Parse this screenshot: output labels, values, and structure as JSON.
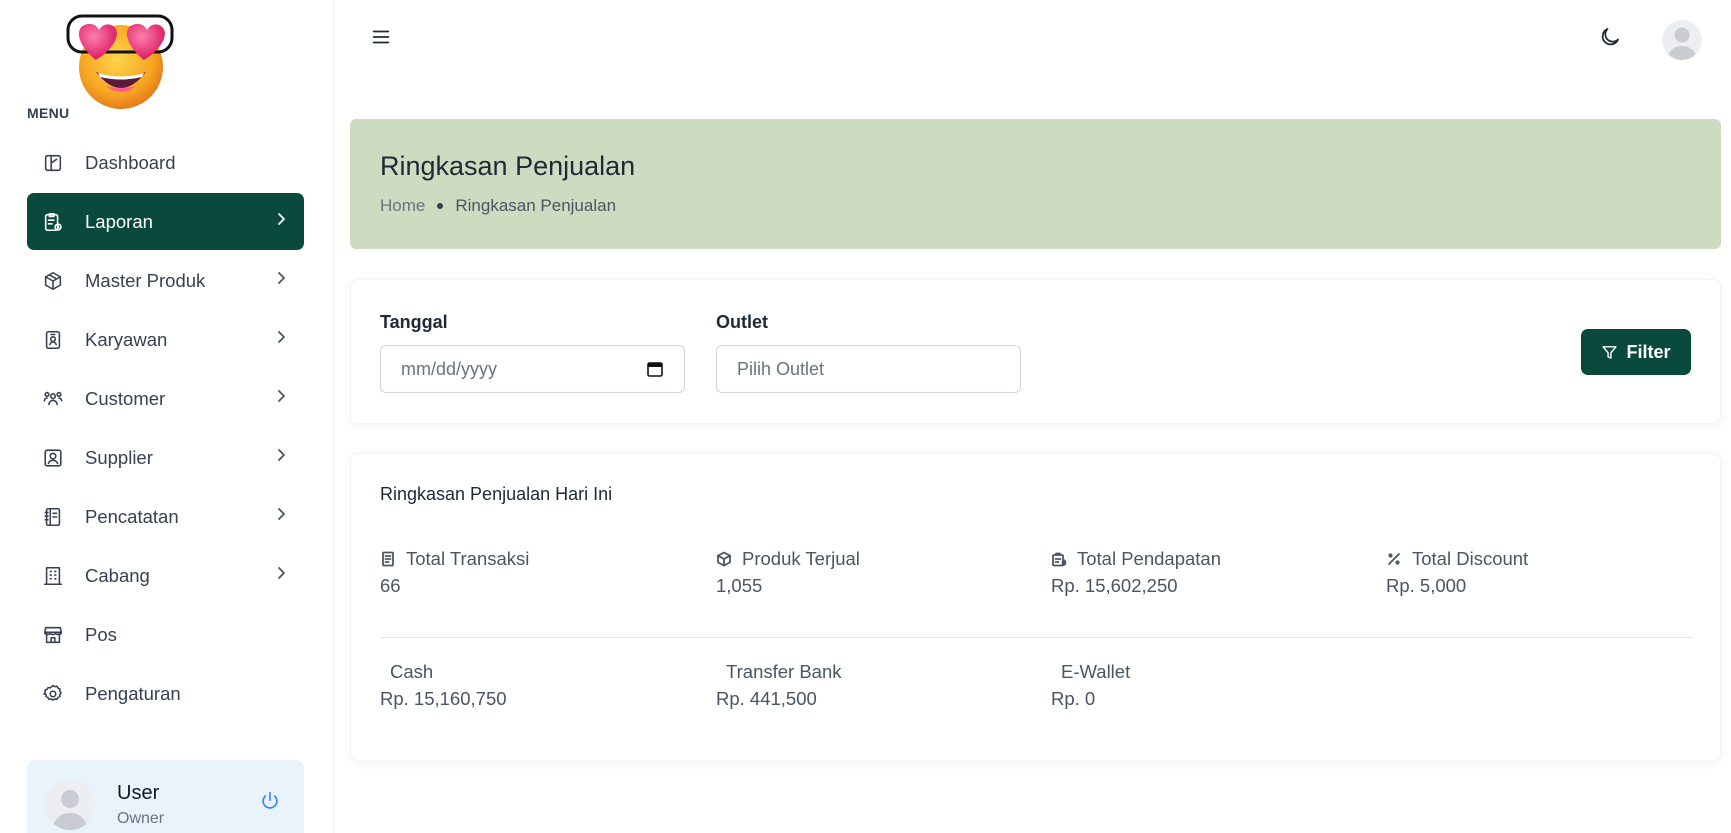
{
  "sidebar": {
    "menu_caption": "MENU",
    "items": [
      {
        "label": "Dashboard",
        "icon": "dashboard-icon",
        "has_chevron": false,
        "active": false
      },
      {
        "label": "Laporan",
        "icon": "report-icon",
        "has_chevron": true,
        "active": true
      },
      {
        "label": "Master Produk",
        "icon": "box-icon",
        "has_chevron": true,
        "active": false
      },
      {
        "label": "Karyawan",
        "icon": "badge-icon",
        "has_chevron": true,
        "active": false
      },
      {
        "label": "Customer",
        "icon": "users-icon",
        "has_chevron": true,
        "active": false
      },
      {
        "label": "Supplier",
        "icon": "contact-icon",
        "has_chevron": true,
        "active": false
      },
      {
        "label": "Pencatatan",
        "icon": "notebook-icon",
        "has_chevron": true,
        "active": false
      },
      {
        "label": "Cabang",
        "icon": "building-icon",
        "has_chevron": true,
        "active": false
      },
      {
        "label": "Pos",
        "icon": "store-icon",
        "has_chevron": false,
        "active": false
      },
      {
        "label": "Pengaturan",
        "icon": "gear-icon",
        "has_chevron": false,
        "active": false
      }
    ],
    "user": {
      "name": "User",
      "role": "Owner"
    }
  },
  "page": {
    "title": "Ringkasan Penjualan",
    "breadcrumb": {
      "home": "Home",
      "current": "Ringkasan Penjualan"
    }
  },
  "filter": {
    "date_label": "Tanggal",
    "date_placeholder": "mm/dd/yyyy",
    "outlet_label": "Outlet",
    "outlet_placeholder": "Pilih Outlet",
    "button_label": "Filter"
  },
  "summary": {
    "title": "Ringkasan Penjualan Hari Ini",
    "stats": [
      {
        "label": "Total Transaksi",
        "value": "66",
        "icon": "receipt-icon"
      },
      {
        "label": "Produk Terjual",
        "value": "1,055",
        "icon": "box-icon"
      },
      {
        "label": "Total Pendapatan",
        "value": "Rp. 15,602,250",
        "icon": "revenue-icon"
      },
      {
        "label": "Total Discount",
        "value": "Rp. 5,000",
        "icon": "percent-icon"
      }
    ],
    "payments": [
      {
        "label": "Cash",
        "value": "Rp. 15,160,750"
      },
      {
        "label": "Transfer Bank",
        "value": "Rp. 441,500"
      },
      {
        "label": "E-Wallet",
        "value": "Rp. 0"
      }
    ]
  },
  "colors": {
    "primary": "#0a4a3c",
    "header_bg": "#ccdcc0",
    "user_card_bg": "#e8f3fb"
  }
}
